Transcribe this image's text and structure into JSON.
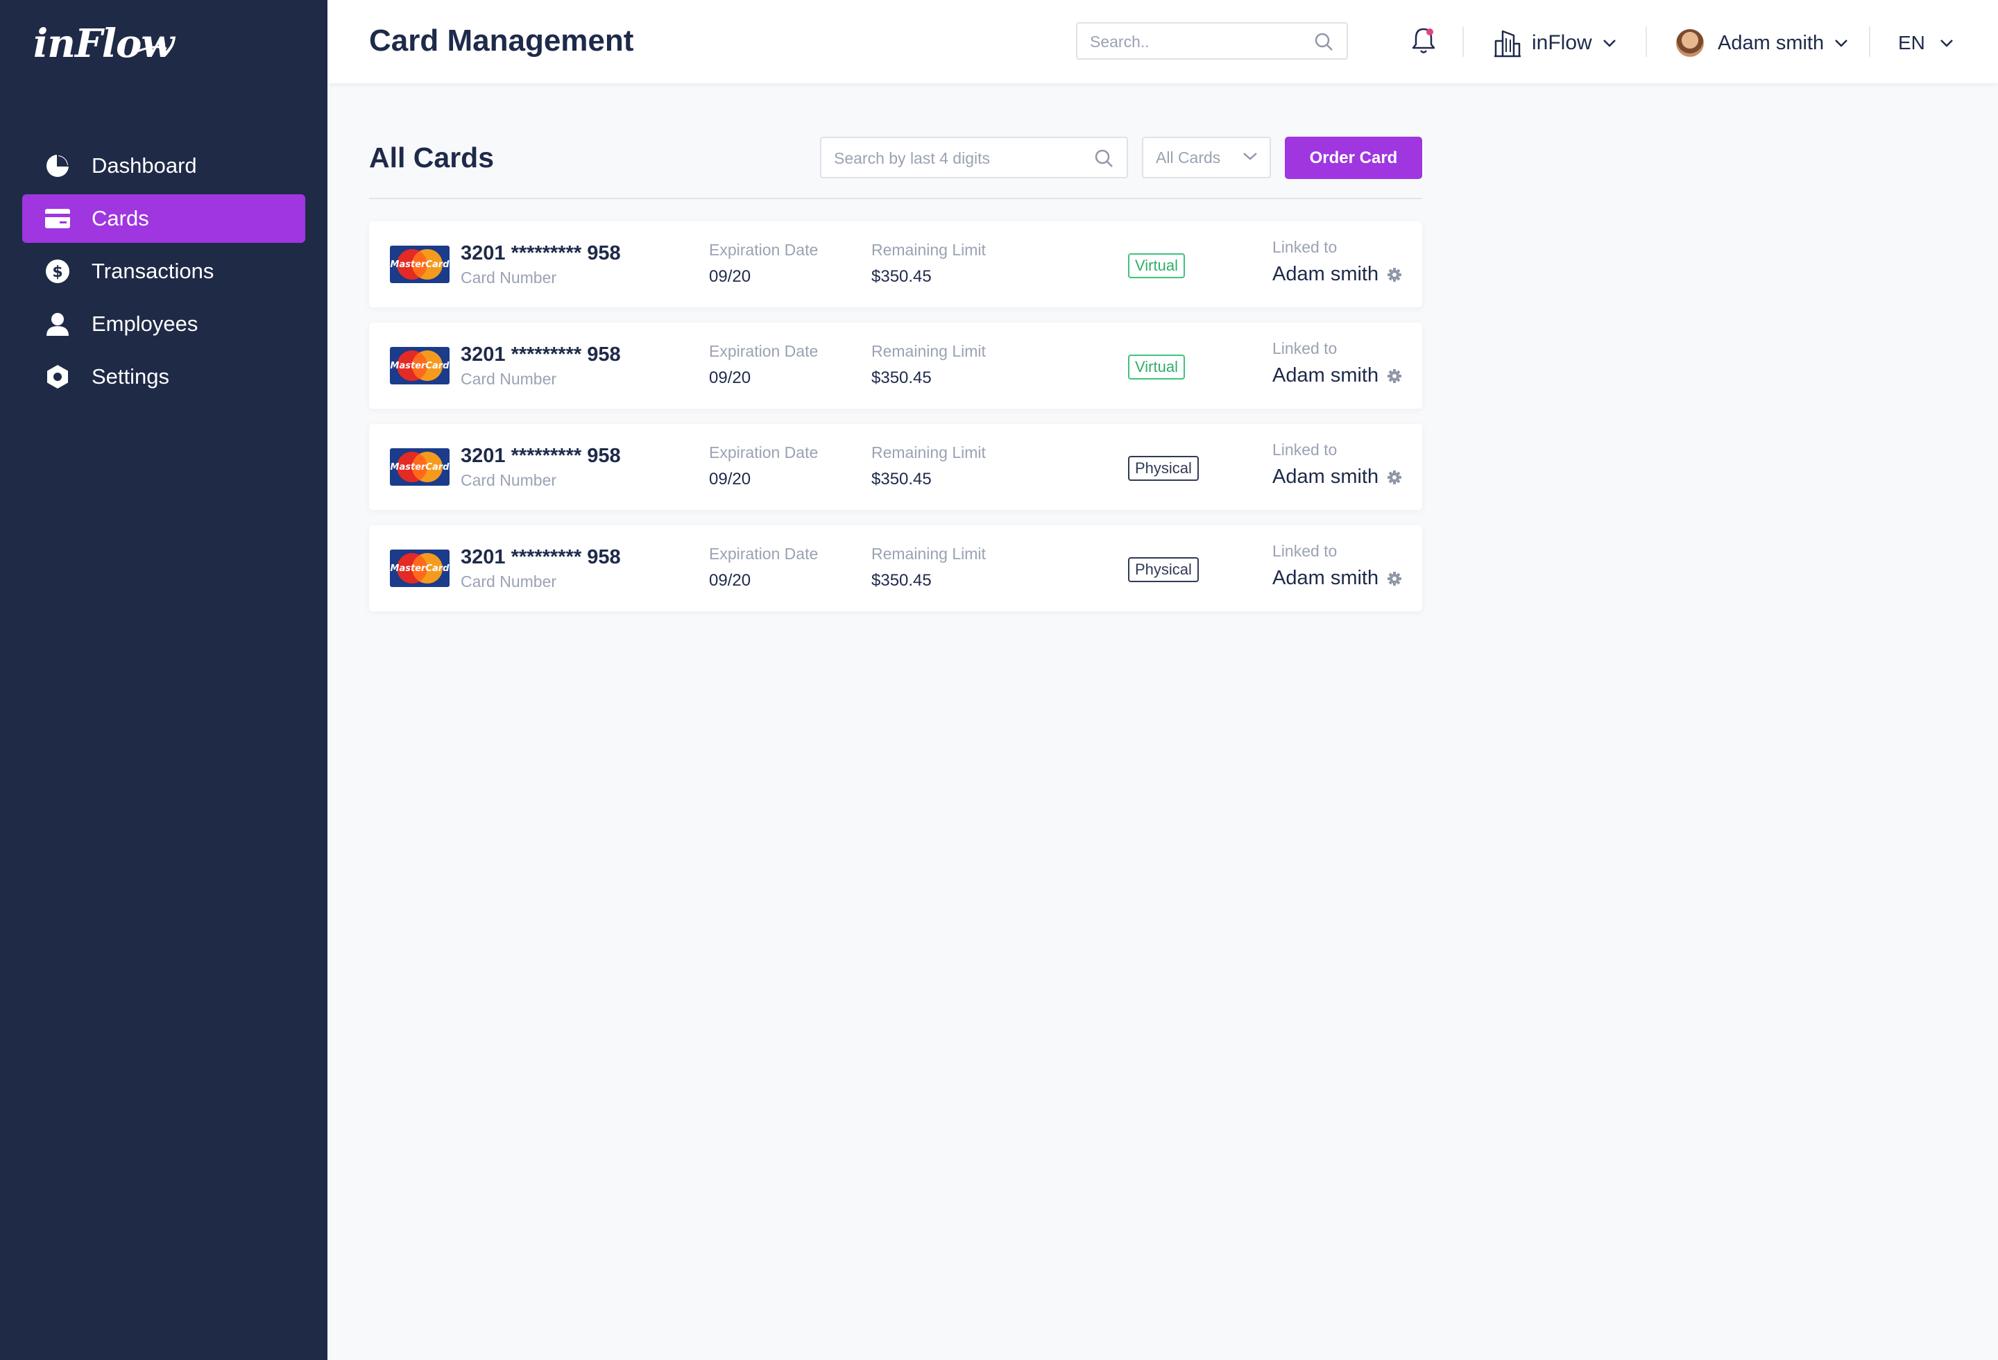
{
  "app": {
    "logo_text": "inFlow",
    "page_title": "Card Management"
  },
  "sidebar": {
    "items": [
      {
        "label": "Dashboard",
        "icon": "pie-chart-icon",
        "active": false
      },
      {
        "label": "Cards",
        "icon": "credit-card-icon",
        "active": true
      },
      {
        "label": "Transactions",
        "icon": "dollar-icon",
        "active": false
      },
      {
        "label": "Employees",
        "icon": "person-icon",
        "active": false
      },
      {
        "label": "Settings",
        "icon": "hexagon-settings-icon",
        "active": false
      }
    ]
  },
  "header": {
    "search_placeholder": "Search..",
    "org_name": "inFlow",
    "user_name": "Adam smith",
    "language": "EN"
  },
  "main": {
    "section_title": "All Cards",
    "card_search_placeholder": "Search by last 4 digits",
    "filter_value": "All Cards",
    "order_button": "Order Card",
    "cards": [
      {
        "brand": "MasterCard",
        "number": "3201 ********* 958",
        "number_label": "Card Number",
        "expiration_label": "Expiration Date",
        "expiration": "09/20",
        "limit_label": "Remaining Limit",
        "limit": "$350.45",
        "type": "Virtual",
        "linked_label": "Linked to",
        "linked_to": "Adam smith"
      },
      {
        "brand": "MasterCard",
        "number": "3201 ********* 958",
        "number_label": "Card Number",
        "expiration_label": "Expiration Date",
        "expiration": "09/20",
        "limit_label": "Remaining Limit",
        "limit": "$350.45",
        "type": "Virtual",
        "linked_label": "Linked to",
        "linked_to": "Adam smith"
      },
      {
        "brand": "MasterCard",
        "number": "3201 ********* 958",
        "number_label": "Card Number",
        "expiration_label": "Expiration Date",
        "expiration": "09/20",
        "limit_label": "Remaining Limit",
        "limit": "$350.45",
        "type": "Physical",
        "linked_label": "Linked to",
        "linked_to": "Adam smith"
      },
      {
        "brand": "MasterCard",
        "number": "3201 ********* 958",
        "number_label": "Card Number",
        "expiration_label": "Expiration Date",
        "expiration": "09/20",
        "limit_label": "Remaining Limit",
        "limit": "$350.45",
        "type": "Physical",
        "linked_label": "Linked to",
        "linked_to": "Adam smith"
      }
    ]
  },
  "colors": {
    "sidebar_bg": "#1f2a47",
    "accent": "#9f36e0",
    "virtual_badge": "#3cc47c",
    "physical_badge": "#303a56",
    "notification_dot": "#e0457b"
  }
}
